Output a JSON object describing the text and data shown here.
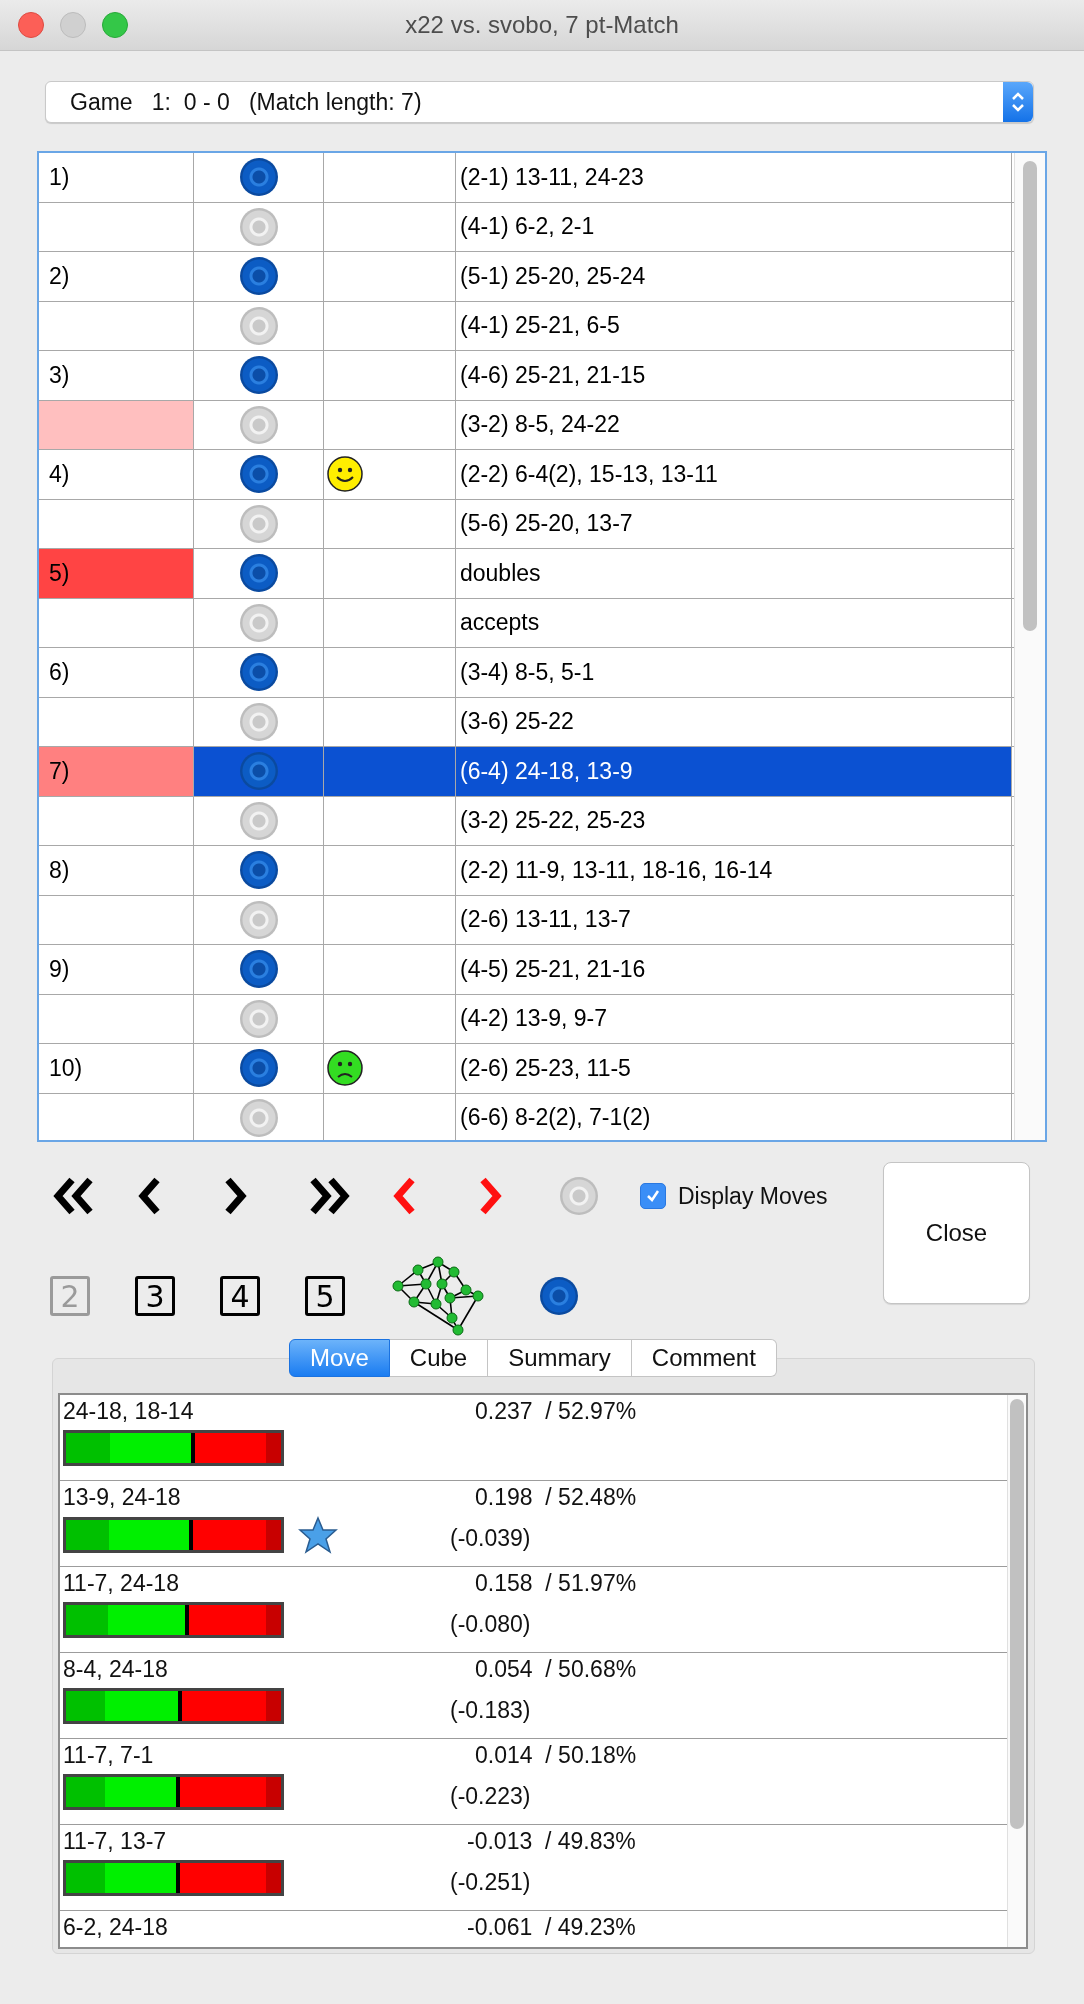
{
  "window": {
    "title": "x22 vs. svobo,  7 pt-Match"
  },
  "game_select": {
    "value": "Game   1:  0 - 0   (Match length: 7)"
  },
  "moves_table": {
    "rows": [
      {
        "number": "1)",
        "checker": {
          "kind": "dark"
        },
        "move": "(2-1) 13-11, 24-23",
        "selected": false
      },
      {
        "number": "",
        "checker": {
          "kind": "light"
        },
        "move": "(4-1) 6-2, 2-1",
        "selected": false
      },
      {
        "number": "2)",
        "checker": {
          "kind": "dark"
        },
        "move": "(5-1) 25-20, 25-24",
        "selected": false
      },
      {
        "number": "",
        "checker": {
          "kind": "light"
        },
        "move": "(4-1) 25-21, 6-5",
        "selected": false
      },
      {
        "number": "3)",
        "checker": {
          "kind": "dark"
        },
        "move": "(4-6) 25-21, 21-15",
        "selected": false
      },
      {
        "number": "",
        "checker": {
          "kind": "light"
        },
        "move": "(3-2) 8-5, 24-22",
        "selected": false,
        "color": "#ffbfbf"
      },
      {
        "number": "4)",
        "checker": {
          "kind": "dark"
        },
        "mood": {
          "kind": "happy"
        },
        "move": "(2-2) 6-4(2), 15-13, 13-11",
        "selected": false
      },
      {
        "number": "",
        "checker": {
          "kind": "light"
        },
        "move": "(5-6) 25-20, 13-7",
        "selected": false
      },
      {
        "number": "5)",
        "checker": {
          "kind": "dark"
        },
        "move": "doubles",
        "selected": false,
        "color": "#ff4444"
      },
      {
        "number": "",
        "checker": {
          "kind": "light"
        },
        "move": "accepts",
        "selected": false
      },
      {
        "number": "6)",
        "checker": {
          "kind": "dark"
        },
        "move": "(3-4) 8-5, 5-1",
        "selected": false
      },
      {
        "number": "",
        "checker": {
          "kind": "light"
        },
        "move": "(3-6) 25-22",
        "selected": false
      },
      {
        "number": "7)",
        "checker": {
          "kind": "dark"
        },
        "move": "(6-4) 24-18, 13-9",
        "selected": true,
        "color": "#ff8080"
      },
      {
        "number": "",
        "checker": {
          "kind": "light"
        },
        "move": "(3-2) 25-22, 25-23",
        "selected": false
      },
      {
        "number": "8)",
        "checker": {
          "kind": "dark"
        },
        "move": "(2-2) 11-9, 13-11, 18-16, 16-14",
        "selected": false
      },
      {
        "number": "",
        "checker": {
          "kind": "light"
        },
        "move": "(2-6) 13-11, 13-7",
        "selected": false
      },
      {
        "number": "9)",
        "checker": {
          "kind": "dark"
        },
        "move": "(4-5) 25-21, 21-16",
        "selected": false
      },
      {
        "number": "",
        "checker": {
          "kind": "light"
        },
        "move": "(4-2) 13-9, 9-7",
        "selected": false
      },
      {
        "number": "10)",
        "checker": {
          "kind": "dark"
        },
        "mood": {
          "kind": "sad"
        },
        "move": "(2-6) 25-23, 11-5",
        "selected": false
      },
      {
        "number": "",
        "checker": {
          "kind": "light"
        },
        "move": "(6-6) 8-2(2), 7-1(2)",
        "selected": false
      }
    ]
  },
  "display_moves": {
    "label": "Display Moves",
    "checked": true
  },
  "ply_buttons": [
    {
      "label": "2",
      "disabled": true
    },
    {
      "label": "3",
      "disabled": false
    },
    {
      "label": "4",
      "disabled": false
    },
    {
      "label": "5",
      "disabled": false
    }
  ],
  "close_button": {
    "label": "Close"
  },
  "tabs": [
    {
      "label": "Move",
      "selected": true
    },
    {
      "label": "Cube",
      "selected": false
    },
    {
      "label": "Summary",
      "selected": false
    },
    {
      "label": "Comment",
      "selected": false
    }
  ],
  "analysis": [
    {
      "move": "24-18, 18-14",
      "score": "0.237  / 52.97%",
      "level": 0.6,
      "starred": false
    },
    {
      "move": "13-9, 24-18",
      "score": "0.198  / 52.48%",
      "diff": "(-0.039)",
      "level": 0.59,
      "starred": true
    },
    {
      "move": "11-7, 24-18",
      "score": "0.158  / 51.97%",
      "diff": "(-0.080)",
      "level": 0.57,
      "starred": false
    },
    {
      "move": "8-4, 24-18",
      "score": "0.054  / 50.68%",
      "diff": "(-0.183)",
      "level": 0.54,
      "starred": false
    },
    {
      "move": "11-7, 7-1",
      "score": "0.014  / 50.18%",
      "diff": "(-0.223)",
      "level": 0.53,
      "starred": false
    },
    {
      "move": "11-7, 13-7",
      "score": "-0.013  / 49.83%",
      "diff": "(-0.251)",
      "level": 0.53,
      "starred": false
    },
    {
      "move": "6-2, 24-18",
      "score": "-0.061  / 49.23%",
      "starred": false
    }
  ]
}
